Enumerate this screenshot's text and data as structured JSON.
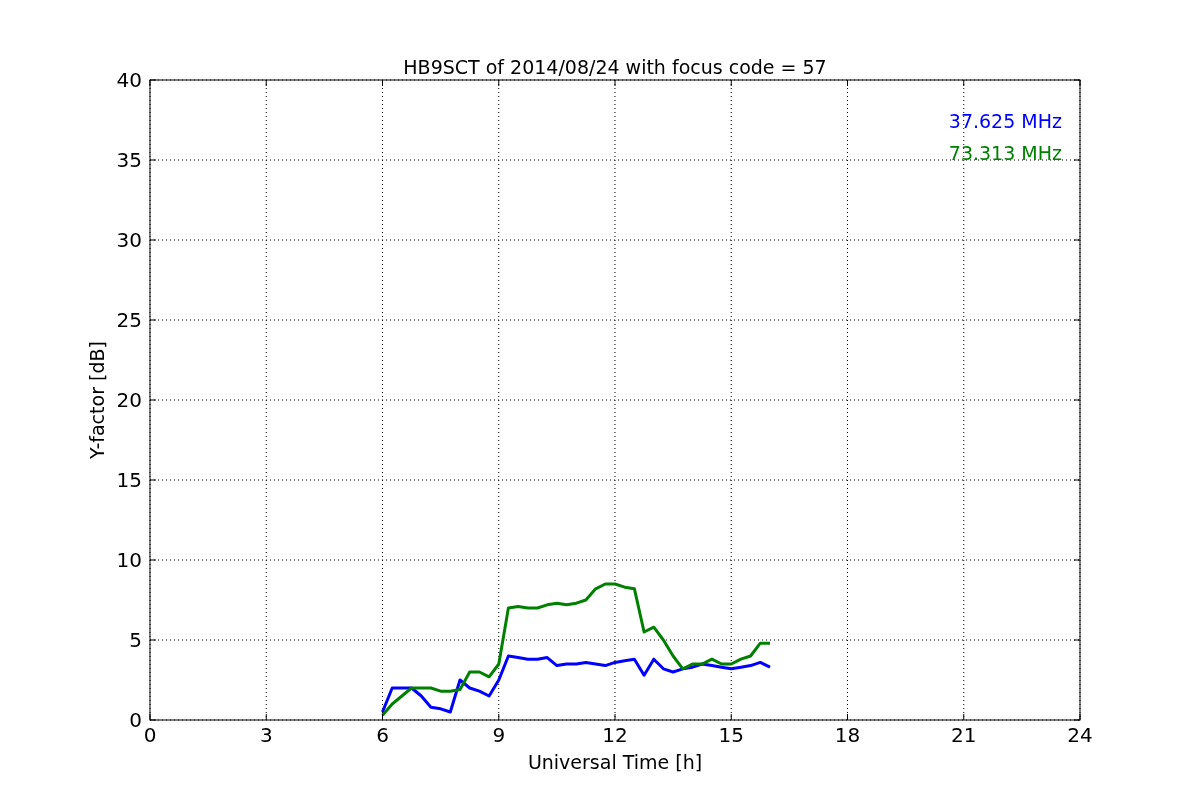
{
  "figure": {
    "chart_data": {
      "type": "line",
      "title": "HB9SCT of 2014/08/24 with focus code = 57",
      "xlabel": "Universal Time [h]",
      "ylabel": "Y-factor [dB]",
      "x": [
        6,
        6.25,
        6.5,
        6.75,
        7,
        7.25,
        7.5,
        7.75,
        8,
        8.25,
        8.5,
        8.75,
        9,
        9.25,
        9.5,
        9.75,
        10,
        10.25,
        10.5,
        10.75,
        11,
        11.25,
        11.5,
        11.75,
        12,
        12.25,
        12.5,
        12.75,
        13,
        13.25,
        13.5,
        13.75,
        14,
        14.25,
        14.5,
        14.75,
        15,
        15.25,
        15.5,
        15.75,
        16
      ],
      "series": [
        {
          "name": "37.625 MHz",
          "color": "#0000ff",
          "values": [
            0.5,
            2,
            2,
            2,
            1.5,
            0.8,
            0.7,
            0.5,
            2.5,
            2,
            1.8,
            1.5,
            2.5,
            4,
            3.9,
            3.8,
            3.8,
            3.9,
            3.4,
            3.5,
            3.5,
            3.6,
            3.5,
            3.4,
            3.6,
            3.7,
            3.8,
            2.8,
            3.8,
            3.2,
            3,
            3.2,
            3.3,
            3.5,
            3.4,
            3.3,
            3.2,
            3.3,
            3.4,
            3.6,
            3.3
          ]
        },
        {
          "name": "73.313 MHz",
          "color": "#008000",
          "values": [
            0.3,
            1,
            1.5,
            2,
            2,
            2,
            1.8,
            1.8,
            1.9,
            3,
            3,
            2.7,
            3.5,
            7,
            7.1,
            7,
            7,
            7.2,
            7.3,
            7.2,
            7.3,
            7.5,
            8.2,
            8.5,
            8.5,
            8.3,
            8.2,
            5.5,
            5.8,
            5,
            4,
            3.2,
            3.5,
            3.5,
            3.8,
            3.5,
            3.5,
            3.8,
            4,
            4.8,
            4.8
          ]
        }
      ],
      "grid": true,
      "xlim": [
        0,
        24
      ],
      "ylim": [
        0,
        40
      ],
      "xticks": [
        0,
        3,
        6,
        9,
        12,
        15,
        18,
        21,
        24
      ],
      "yticks": [
        0,
        5,
        10,
        15,
        20,
        25,
        30,
        35,
        40
      ]
    }
  }
}
